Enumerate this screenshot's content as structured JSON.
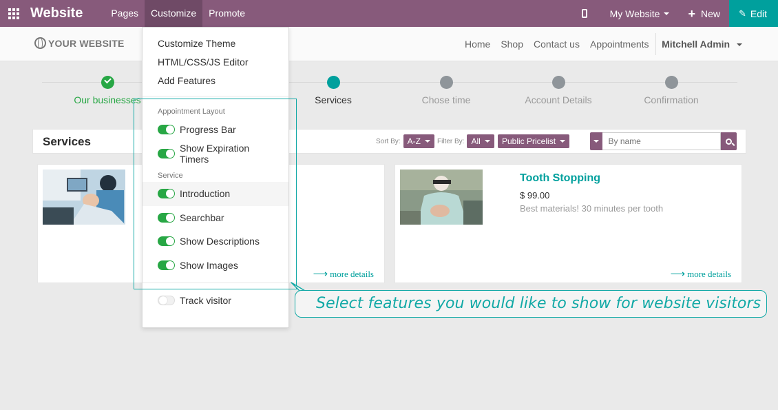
{
  "topbar": {
    "brand": "Website",
    "menu": [
      "Pages",
      "Customize",
      "Promote"
    ],
    "active_menu": "Customize",
    "site_selector": "My Website",
    "new_label": "New",
    "edit_label": "Edit",
    "colors": {
      "bar": "#875a7b",
      "edit": "#00a09d"
    }
  },
  "site_header": {
    "logo_text": "YOUR WEBSITE",
    "nav": [
      "Home",
      "Shop",
      "Contact us",
      "Appointments"
    ],
    "user": "Mitchell Admin"
  },
  "steps": [
    {
      "label": "Our businesses",
      "state": "done"
    },
    {
      "label": "Services",
      "state": "current"
    },
    {
      "label": "Chose time",
      "state": "todo"
    },
    {
      "label": "Account Details",
      "state": "todo"
    },
    {
      "label": "Confirmation",
      "state": "todo"
    }
  ],
  "services_bar": {
    "title": "Services",
    "sort_label": "Sort By:",
    "sort_value": "A-Z",
    "filter_label": "Filter By:",
    "filter_value": "All",
    "pricelist": "Public Pricelist",
    "search_placeholder": "By name"
  },
  "cards": [
    {
      "name": "",
      "price": "",
      "description": "",
      "more": "more details"
    },
    {
      "name": "Tooth Stopping",
      "price": "$ 99.00",
      "description": "Best materials! 30 minutes per tooth",
      "more": "more details"
    }
  ],
  "customize_menu": {
    "items": [
      "Customize Theme",
      "HTML/CSS/JS Editor",
      "Add Features"
    ],
    "groups": [
      {
        "heading": "Appointment Layout",
        "toggles": [
          {
            "label": "Progress Bar",
            "on": true
          },
          {
            "label": "Show Expiration Timers",
            "on": true
          }
        ]
      },
      {
        "heading": "Service",
        "toggles": [
          {
            "label": "Introduction",
            "on": true
          },
          {
            "label": "Searchbar",
            "on": true
          },
          {
            "label": "Show Descriptions",
            "on": true
          },
          {
            "label": "Show Images",
            "on": true
          }
        ]
      }
    ],
    "track_visitor": {
      "label": "Track visitor",
      "on": false
    }
  },
  "callout": {
    "text": "Select features you would like to show for website visitors",
    "color": "#12a9a6"
  }
}
